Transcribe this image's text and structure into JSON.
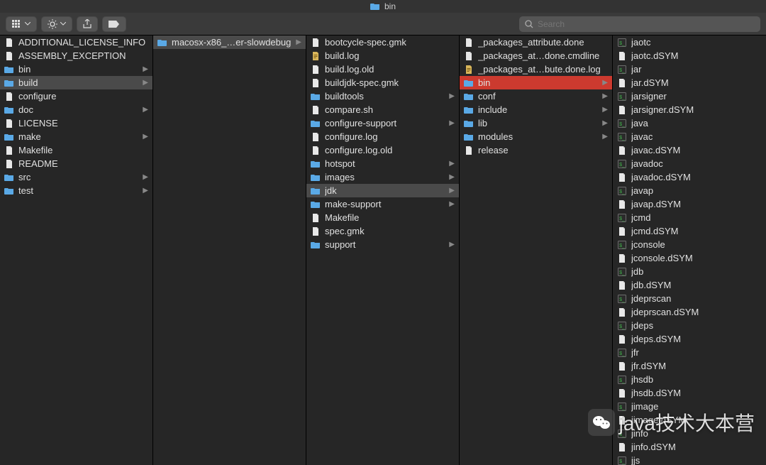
{
  "window": {
    "title": "bin"
  },
  "toolbar": {
    "search_placeholder": "Search"
  },
  "icons": {
    "folder": "folder-icon",
    "file": "file-icon",
    "exec": "exec-icon",
    "log": "log-icon"
  },
  "columns": [
    {
      "items": [
        {
          "name": "ADDITIONAL_LICENSE_INFO",
          "type": "file"
        },
        {
          "name": "ASSEMBLY_EXCEPTION",
          "type": "file"
        },
        {
          "name": "bin",
          "type": "folder",
          "arrow": true
        },
        {
          "name": "build",
          "type": "folder",
          "arrow": true,
          "sel": "path"
        },
        {
          "name": "configure",
          "type": "file"
        },
        {
          "name": "doc",
          "type": "folder",
          "arrow": true
        },
        {
          "name": "LICENSE",
          "type": "file"
        },
        {
          "name": "make",
          "type": "folder",
          "arrow": true
        },
        {
          "name": "Makefile",
          "type": "file"
        },
        {
          "name": "README",
          "type": "file"
        },
        {
          "name": "src",
          "type": "folder",
          "arrow": true
        },
        {
          "name": "test",
          "type": "folder",
          "arrow": true
        }
      ]
    },
    {
      "items": [
        {
          "name": "macosx-x86_…er-slowdebug",
          "type": "folder",
          "arrow": true,
          "sel": "path"
        }
      ]
    },
    {
      "items": [
        {
          "name": "bootcycle-spec.gmk",
          "type": "file"
        },
        {
          "name": "build.log",
          "type": "log"
        },
        {
          "name": "build.log.old",
          "type": "file"
        },
        {
          "name": "buildjdk-spec.gmk",
          "type": "file"
        },
        {
          "name": "buildtools",
          "type": "folder",
          "arrow": true
        },
        {
          "name": "compare.sh",
          "type": "file"
        },
        {
          "name": "configure-support",
          "type": "folder",
          "arrow": true
        },
        {
          "name": "configure.log",
          "type": "file"
        },
        {
          "name": "configure.log.old",
          "type": "file"
        },
        {
          "name": "hotspot",
          "type": "folder",
          "arrow": true
        },
        {
          "name": "images",
          "type": "folder",
          "arrow": true
        },
        {
          "name": "jdk",
          "type": "folder",
          "arrow": true,
          "sel": "path"
        },
        {
          "name": "make-support",
          "type": "folder",
          "arrow": true
        },
        {
          "name": "Makefile",
          "type": "file"
        },
        {
          "name": "spec.gmk",
          "type": "file"
        },
        {
          "name": "support",
          "type": "folder",
          "arrow": true
        }
      ]
    },
    {
      "items": [
        {
          "name": "_packages_attribute.done",
          "type": "file"
        },
        {
          "name": "_packages_at…done.cmdline",
          "type": "file"
        },
        {
          "name": "_packages_at…bute.done.log",
          "type": "log"
        },
        {
          "name": "bin",
          "type": "folder",
          "arrow": true,
          "sel": "active"
        },
        {
          "name": "conf",
          "type": "folder",
          "arrow": true
        },
        {
          "name": "include",
          "type": "folder",
          "arrow": true
        },
        {
          "name": "lib",
          "type": "folder",
          "arrow": true
        },
        {
          "name": "modules",
          "type": "folder",
          "arrow": true
        },
        {
          "name": "release",
          "type": "file"
        }
      ]
    },
    {
      "items": [
        {
          "name": "jaotc",
          "type": "exec"
        },
        {
          "name": "jaotc.dSYM",
          "type": "file"
        },
        {
          "name": "jar",
          "type": "exec"
        },
        {
          "name": "jar.dSYM",
          "type": "file"
        },
        {
          "name": "jarsigner",
          "type": "exec"
        },
        {
          "name": "jarsigner.dSYM",
          "type": "file"
        },
        {
          "name": "java",
          "type": "exec"
        },
        {
          "name": "javac",
          "type": "exec"
        },
        {
          "name": "javac.dSYM",
          "type": "file"
        },
        {
          "name": "javadoc",
          "type": "exec"
        },
        {
          "name": "javadoc.dSYM",
          "type": "file"
        },
        {
          "name": "javap",
          "type": "exec"
        },
        {
          "name": "javap.dSYM",
          "type": "file"
        },
        {
          "name": "jcmd",
          "type": "exec"
        },
        {
          "name": "jcmd.dSYM",
          "type": "file"
        },
        {
          "name": "jconsole",
          "type": "exec"
        },
        {
          "name": "jconsole.dSYM",
          "type": "file"
        },
        {
          "name": "jdb",
          "type": "exec"
        },
        {
          "name": "jdb.dSYM",
          "type": "file"
        },
        {
          "name": "jdeprscan",
          "type": "exec"
        },
        {
          "name": "jdeprscan.dSYM",
          "type": "file"
        },
        {
          "name": "jdeps",
          "type": "exec"
        },
        {
          "name": "jdeps.dSYM",
          "type": "file"
        },
        {
          "name": "jfr",
          "type": "exec"
        },
        {
          "name": "jfr.dSYM",
          "type": "file"
        },
        {
          "name": "jhsdb",
          "type": "exec"
        },
        {
          "name": "jhsdb.dSYM",
          "type": "file"
        },
        {
          "name": "jimage",
          "type": "exec"
        },
        {
          "name": "jimage.dSYM",
          "type": "file"
        },
        {
          "name": "jinfo",
          "type": "exec"
        },
        {
          "name": "jinfo.dSYM",
          "type": "file"
        },
        {
          "name": "jjs",
          "type": "exec"
        }
      ]
    }
  ],
  "watermark": {
    "text": "java技术大本营"
  }
}
